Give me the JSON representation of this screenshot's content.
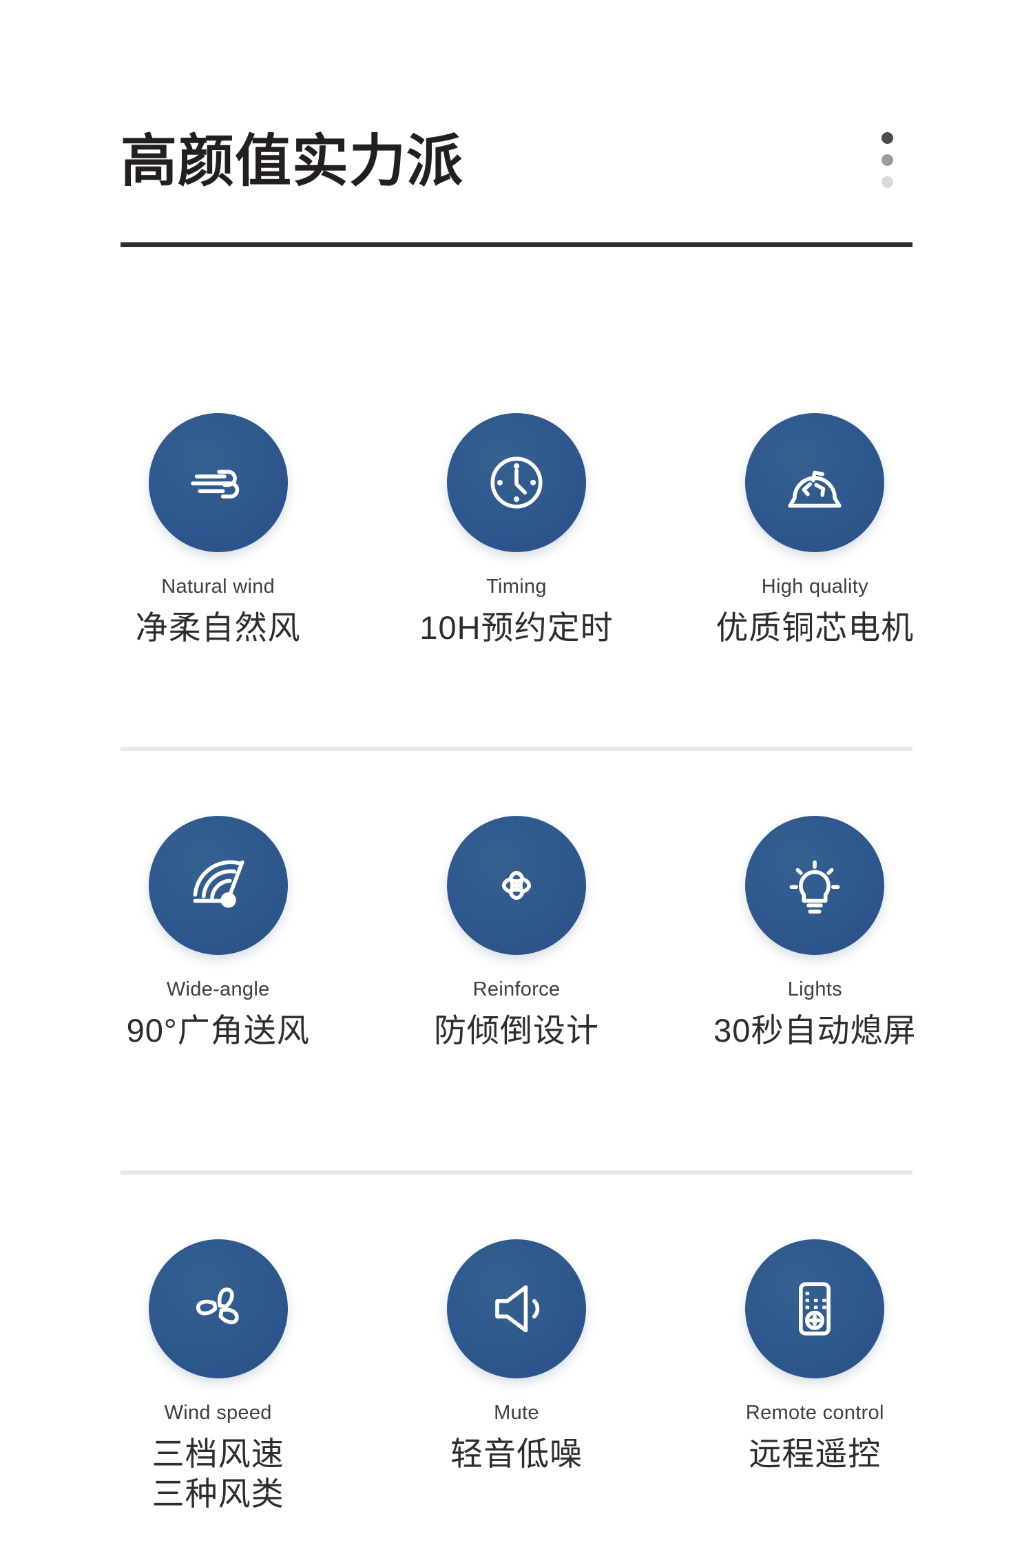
{
  "header": {
    "title": "高颜值实力派",
    "menu_dots": [
      "dot-dark",
      "dot-medium",
      "dot-light"
    ]
  },
  "colors": {
    "icon_circle_blue": "#2E578E",
    "title_text": "#231F20",
    "title_rule": "#2E2E2E",
    "section_divider": "#E8E8E8",
    "english_label": "#3E3E3E",
    "chinese_label": "#2D2D2D"
  },
  "features": [
    {
      "icon": "wind-icon",
      "en": "Natural wind",
      "cn": "净柔自然风"
    },
    {
      "icon": "clock-icon",
      "en": "Timing",
      "cn": "10H预约定时"
    },
    {
      "icon": "motor-icon",
      "en": "High quality",
      "cn": "优质铜芯电机"
    },
    {
      "icon": "gauge-icon",
      "en": "Wide-angle",
      "cn": "90°广角送风"
    },
    {
      "icon": "base-stand-icon",
      "en": "Reinforce",
      "cn": "防倾倒设计"
    },
    {
      "icon": "lightbulb-icon",
      "en": "Lights",
      "cn": "30秒自动熄屏"
    },
    {
      "icon": "fan-blade-icon",
      "en": "Wind speed",
      "cn": "三档风速\n三种风类"
    },
    {
      "icon": "speaker-mute-icon",
      "en": "Mute",
      "cn": "轻音低噪"
    },
    {
      "icon": "remote-control-icon",
      "en": "Remote control",
      "cn": "远程遥控"
    }
  ]
}
